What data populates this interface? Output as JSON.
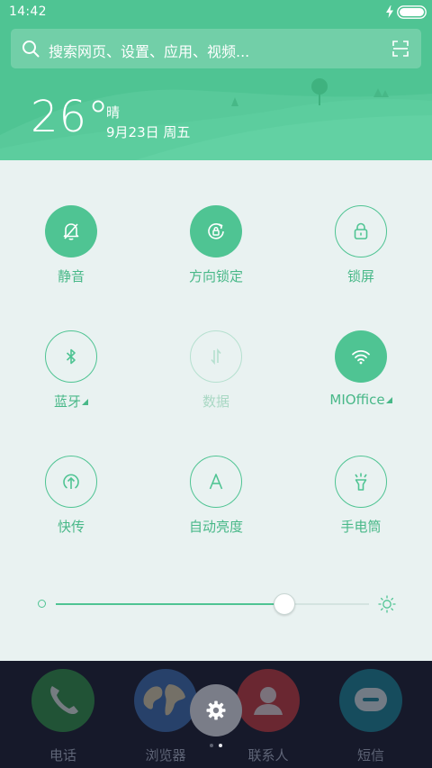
{
  "status_bar": {
    "time": "14:42",
    "icons": [
      "bolt-icon",
      "battery-icon"
    ]
  },
  "search": {
    "placeholder": "搜索网页、设置、应用、视频..."
  },
  "weather": {
    "temperature": "26°",
    "condition": "晴",
    "date": "9月23日  周五"
  },
  "toggles": [
    {
      "label": "静音",
      "icon": "bell-off-icon",
      "state": "active"
    },
    {
      "label": "方向锁定",
      "icon": "rotation-lock-icon",
      "state": "active"
    },
    {
      "label": "锁屏",
      "icon": "lock-icon",
      "state": "inactive"
    },
    {
      "label": "蓝牙",
      "icon": "bluetooth-icon",
      "state": "inactive",
      "has_submenu": true
    },
    {
      "label": "数据",
      "icon": "data-icon",
      "state": "disabled"
    },
    {
      "label": "MIOffice",
      "icon": "wifi-icon",
      "state": "active",
      "has_submenu": true
    },
    {
      "label": "快传",
      "icon": "share-icon",
      "state": "inactive"
    },
    {
      "label": "自动亮度",
      "icon": "auto-brightness-icon",
      "state": "inactive"
    },
    {
      "label": "手电筒",
      "icon": "flashlight-icon",
      "state": "inactive"
    }
  ],
  "brightness": {
    "level": 0.73
  },
  "dock": {
    "apps": [
      {
        "label": "电话",
        "icon": "phone-icon"
      },
      {
        "label": "浏览器",
        "icon": "browser-icon"
      },
      {
        "label": "联系人",
        "icon": "contacts-icon"
      },
      {
        "label": "短信",
        "icon": "messages-icon"
      }
    ],
    "settings_icon": "gear-icon",
    "page_indicator": {
      "pages": 2,
      "current": 2
    }
  },
  "colors": {
    "accent": "#4fc493",
    "panel_bg": "#e9f2f1",
    "dock_bg": "#16192a"
  }
}
